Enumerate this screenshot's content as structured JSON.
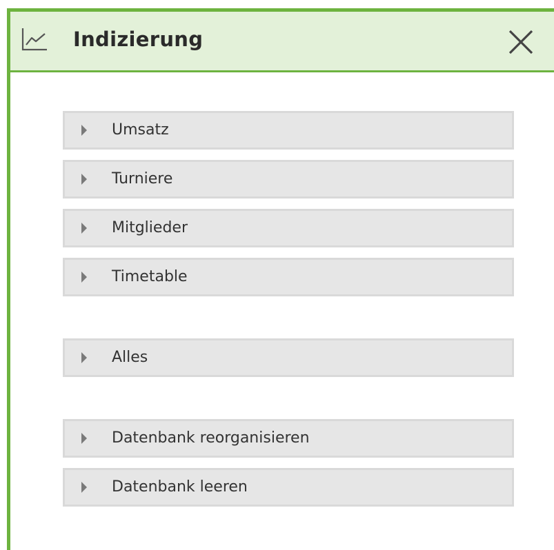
{
  "window": {
    "title": "Indizierung",
    "icon": "line-chart-icon",
    "close_icon": "close-icon"
  },
  "actions": [
    {
      "label": "Umsatz"
    },
    {
      "label": "Turniere"
    },
    {
      "label": "Mitglieder"
    },
    {
      "label": "Timetable"
    },
    {
      "label": "Alles"
    },
    {
      "label": "Datenbank reorganisieren"
    },
    {
      "label": "Datenbank leeren"
    }
  ],
  "colors": {
    "accent": "#6db33f",
    "titlebar_bg": "#e3f1d9",
    "row_bg": "#e6e6e6",
    "row_border": "#d9d9d9",
    "arrow": "#7a7a7a"
  }
}
